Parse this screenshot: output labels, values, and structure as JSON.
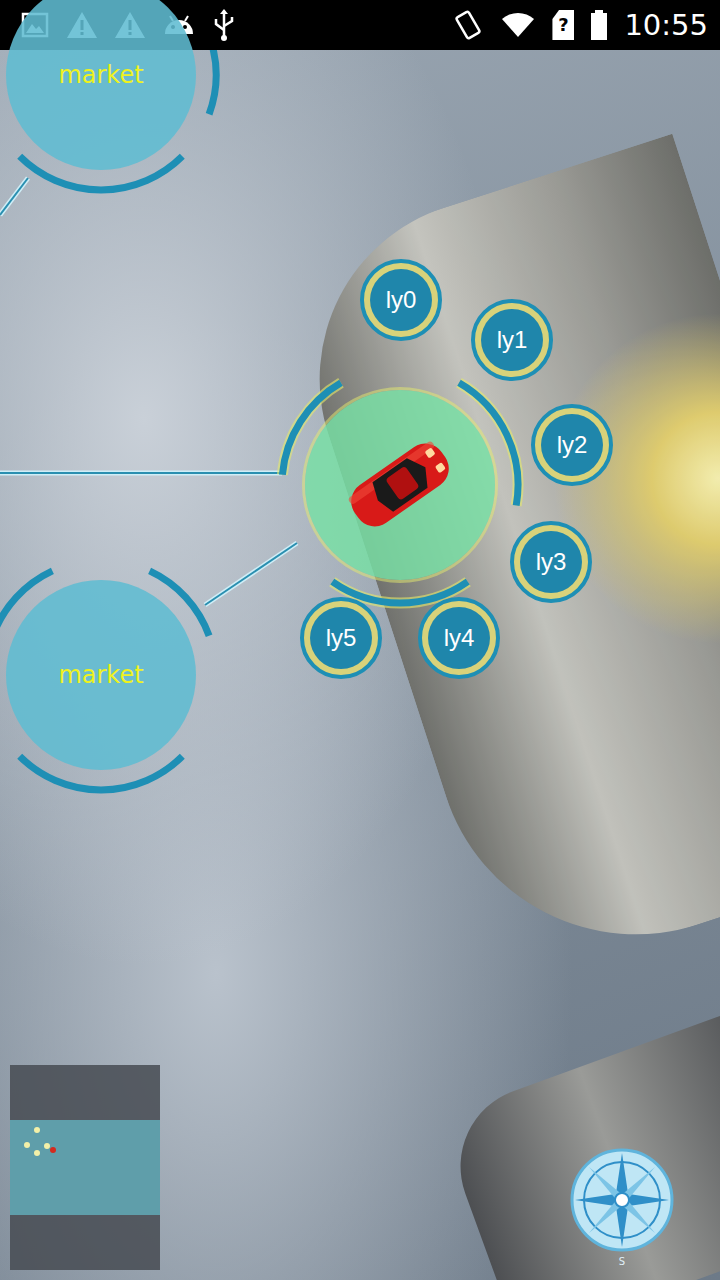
{
  "status_bar": {
    "time": "10:55",
    "sim_status": "?"
  },
  "markets": [
    {
      "label": "market"
    },
    {
      "label": "market"
    }
  ],
  "vehicle_node": {
    "selected": true
  },
  "layers": [
    {
      "label": "ly0"
    },
    {
      "label": "ly1"
    },
    {
      "label": "ly2"
    },
    {
      "label": "ly3"
    },
    {
      "label": "ly4"
    },
    {
      "label": "ly5"
    }
  ],
  "minimap": {
    "markers": [
      {
        "color": "#f3f0a8"
      },
      {
        "color": "#f3f0a8"
      },
      {
        "color": "#f3f0a8"
      },
      {
        "color": "#f3f0a8"
      },
      {
        "color": "#d42a1e"
      }
    ]
  },
  "compass": {
    "label": "S"
  }
}
